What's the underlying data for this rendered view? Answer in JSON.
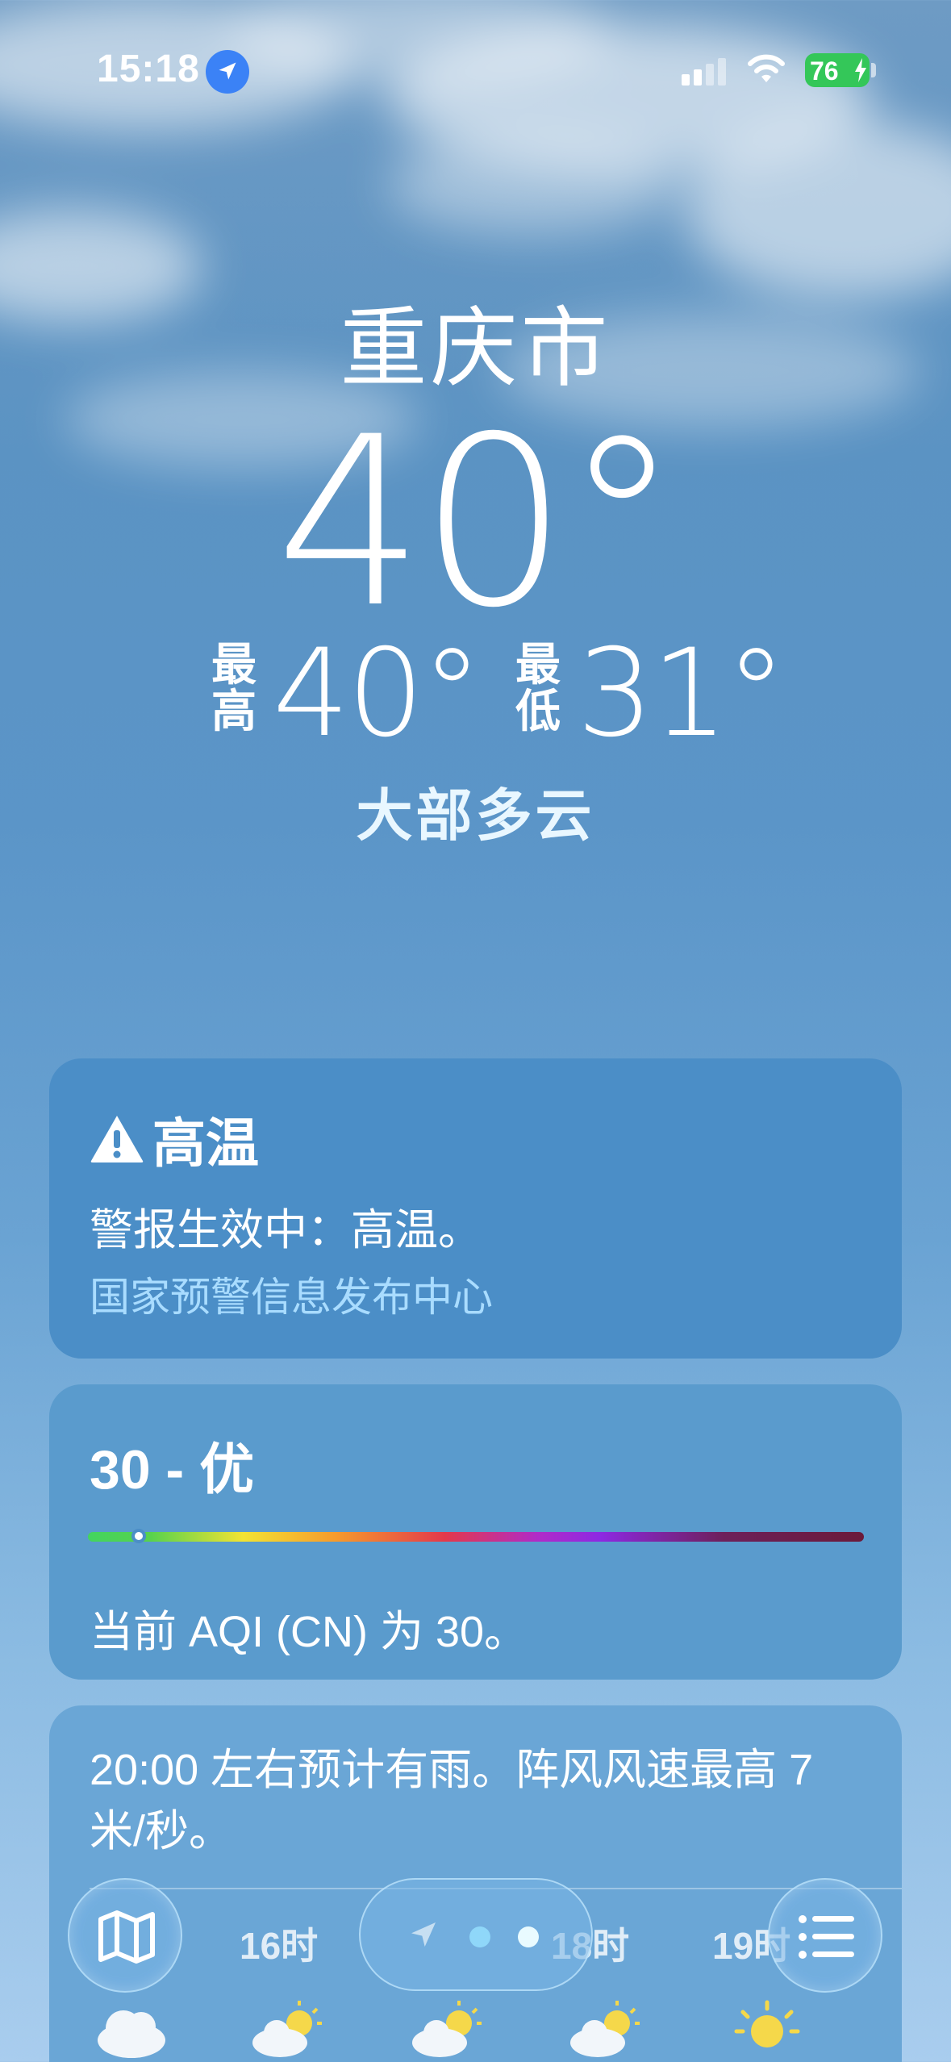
{
  "status_bar": {
    "time": "15:18",
    "battery": "76",
    "icons": [
      "location-arrow-icon",
      "cellular-signal-icon",
      "wifi-icon",
      "battery-charging-icon"
    ]
  },
  "weather": {
    "city": "重庆市",
    "current_temp": "40°",
    "high_label": "最高",
    "high_value": "40°",
    "low_label": "最低",
    "low_value": "31°",
    "condition": "大部多云"
  },
  "alert_card": {
    "title": "高温",
    "text": "警报生效中：高温。",
    "source": "国家预警信息发布中心"
  },
  "aqi_card": {
    "title": "30 - 优",
    "value": 30,
    "description": "当前 AQI (CN) 为 30。"
  },
  "forecast_card": {
    "text": "20:00 左右预计有雨。阵风风速最高 7 米/秒。",
    "hours": [
      "16时",
      "18时",
      "19时"
    ],
    "icons": [
      "cloud-icon",
      "partly-sunny-icon",
      "partly-sunny-icon",
      "partly-sunny-icon",
      "sun-icon"
    ]
  },
  "toolbar": {
    "map_icon": "map-icon",
    "list_icon": "list-icon",
    "pages": 2,
    "current_page": 2
  },
  "colors": {
    "alert_source": "#a9dcff",
    "battery": "#34c759",
    "location_dot": "#3b82f6"
  }
}
